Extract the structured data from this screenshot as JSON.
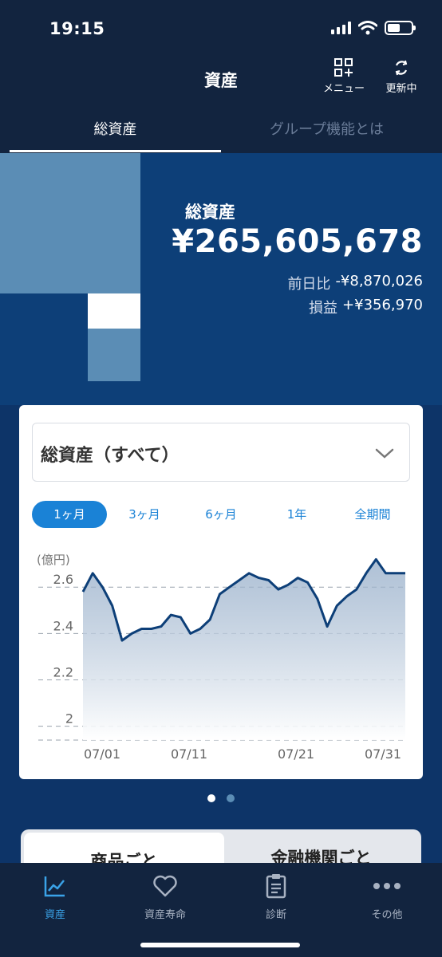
{
  "status_bar": {
    "time": "19:15"
  },
  "header": {
    "title": "資産",
    "menu_label": "メニュー",
    "refresh_label": "更新中"
  },
  "tabs": [
    {
      "label": "総資産",
      "active": true
    },
    {
      "label": "グループ機能とは",
      "active": false
    }
  ],
  "summary": {
    "label": "総資産",
    "total": "¥265,605,678",
    "day_change_label": "前日比",
    "day_change_value": "-¥8,870,026",
    "pl_label": "損益",
    "pl_value": "+¥356,970"
  },
  "card": {
    "selector_value": "総資産（すべて）",
    "periods": [
      "1ヶ月",
      "3ヶ月",
      "6ヶ月",
      "1年",
      "全期間"
    ],
    "active_period": "1ヶ月"
  },
  "chart_data": {
    "type": "area",
    "unit_label": "(億円)",
    "y_ticks": [
      "2.6",
      "2.4",
      "2.2",
      "2"
    ],
    "x_ticks": [
      "07/01",
      "07/11",
      "07/21",
      "07/31"
    ],
    "ylim": [
      1.94,
      2.68
    ],
    "x": [
      0,
      1,
      2,
      3,
      4,
      5,
      6,
      7,
      8,
      9,
      10,
      11,
      12,
      13,
      14,
      15,
      16,
      17,
      18,
      19,
      20,
      21,
      22,
      23,
      24,
      25,
      26,
      27,
      28,
      29,
      30,
      31,
      32,
      33
    ],
    "y": [
      2.58,
      2.66,
      2.6,
      2.52,
      2.37,
      2.4,
      2.42,
      2.42,
      2.43,
      2.48,
      2.47,
      2.4,
      2.42,
      2.46,
      2.57,
      2.6,
      2.63,
      2.66,
      2.64,
      2.63,
      2.59,
      2.61,
      2.64,
      2.62,
      2.55,
      2.43,
      2.52,
      2.56,
      2.59,
      2.66,
      2.72,
      2.66,
      2.66,
      2.66
    ],
    "color": "#0d3f78",
    "grid": true
  },
  "segmented": [
    "商品ごと",
    "金融機関ごと"
  ],
  "bottom_nav": [
    {
      "label": "資産",
      "icon": "chart-icon",
      "active": true
    },
    {
      "label": "資産寿命",
      "icon": "heart-icon",
      "active": false
    },
    {
      "label": "診断",
      "icon": "clipboard-icon",
      "active": false
    },
    {
      "label": "その他",
      "icon": "more-icon",
      "active": false
    }
  ],
  "colors": {
    "navy": "#12243f",
    "hero_blue": "#0d3f78",
    "accent": "#1a82d6",
    "active_nav": "#3aa3e8"
  }
}
